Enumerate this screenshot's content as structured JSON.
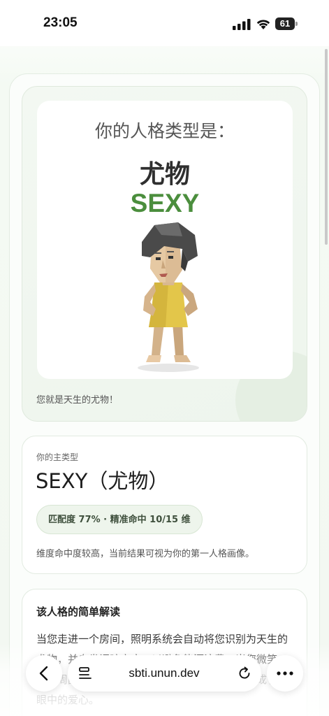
{
  "status_bar": {
    "time": "23:05",
    "battery_level": "61"
  },
  "hero": {
    "label": "你的人格类型是：",
    "name": "尤物",
    "code": "SEXY",
    "caption": "您就是天生的尤物！",
    "accent_color": "#4b8e3d"
  },
  "main_type": {
    "label": "你的主类型",
    "title": "SEXY（尤物）",
    "match": "匹配度 77% · 精准命中 10/15 维",
    "description": "维度命中度较高，当前结果可视为你的第一人格画像。"
  },
  "explanation": {
    "title": "该人格的简单解读",
    "body": "当您走进一个房间，照明系统会自动将您识别为天生的尤物，并自发调暗亮度，以避免能源浪费。当您微笑时，周围的湿度会显著下降，因为水蒸气都凝结成了人眼中的爱心。"
  },
  "browser": {
    "url": "sbti.unun.dev",
    "icons": [
      "back-arrow-icon",
      "tabs-icon",
      "reload-icon",
      "more-icon"
    ]
  }
}
